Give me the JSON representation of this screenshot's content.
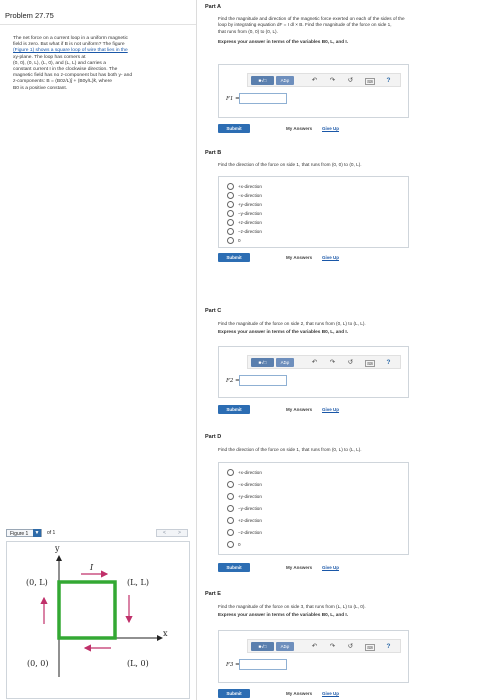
{
  "problem": {
    "title": "Problem 27.75",
    "text_lines": [
      "The net force on a current loop in a uniform magnetic",
      "field is zero. But what if B is not uniform? The figure",
      "(Figure 1) shows a square loop of wire that lies in the",
      "xy-plane. The loop has corners at",
      "(0, 0), (0, L), (L, 0), and (L, L) and carries a",
      "constant current I in the clockwise direction. The",
      "magnetic field has no z-component but has both y- and",
      "z-components: B = (B0z/L)ĵ + (B0y/L)k̂, where",
      "B0 is a positive constant."
    ],
    "figure_link": "(Figure 1)"
  },
  "figure": {
    "selector": "Figure 1",
    "of": "of 1",
    "prev": "<",
    "next": ">",
    "axis_y": "y",
    "axis_x": "x",
    "corner_tl": "(0, L)",
    "corner_tr": "(L, L)",
    "corner_bl": "(0, 0)",
    "corner_br": "(L, 0)",
    "current": "I"
  },
  "toolbar": {
    "math": "■√□",
    "greek": "AΣφ",
    "undo": "↶",
    "redo": "↷",
    "reset": "↺",
    "keyboard": "⌨",
    "help": "?"
  },
  "common": {
    "submit": "Submit",
    "my_answers": "My Answers",
    "give_up": "Give Up"
  },
  "partA": {
    "label": "Part A",
    "q1": "Find the magnitude and direction of the magnetic force exerted on each of the sides of the",
    "q2": "loop by integrating equation dF = I dl × B. Find the magnitude of the force on side 1,",
    "q3": "that runs from (0, 0) to (0, L).",
    "instruction": "Express your answer in terms of the variables B0, L, and I.",
    "var": "F1 ="
  },
  "partB": {
    "label": "Part B",
    "q1": "Find the direction of the force on side 1, that runs from (0, 0) to (0, L).",
    "options": [
      "+x-direction",
      "−x-direction",
      "+y-direction",
      "−y-direction",
      "+z-direction",
      "−z-direction",
      "0"
    ]
  },
  "partC": {
    "label": "Part C",
    "q1": "Find the magnitude of the force on side 2, that runs from (0, L) to (L, L).",
    "instruction": "Express your answer in terms of the variables B0, L, and I.",
    "var": "F2 ="
  },
  "partD": {
    "label": "Part D",
    "q1": "Find the direction of the force on side 1, that runs from (0, L) to (L, L).",
    "options": [
      "+x-direction",
      "−x-direction",
      "+y-direction",
      "−y-direction",
      "+z-direction",
      "−z-direction",
      "0"
    ]
  },
  "partE": {
    "label": "Part E",
    "q1": "Find the magnitude of the force on side 3, that runs from (L, L) to (L, 0).",
    "instruction": "Express your answer in terms of the variables B0, L, and I.",
    "var": "F3 ="
  },
  "colors": {
    "loop": "#33a833",
    "arrow": "#c0306a",
    "submit": "#2c6db3",
    "link": "#1a57a8"
  }
}
